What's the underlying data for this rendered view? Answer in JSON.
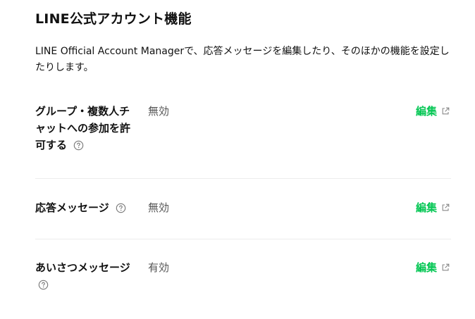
{
  "section": {
    "title": "LINE公式アカウント機能",
    "description": "LINE Official Account Managerで、応答メッセージを編集したり、そのほかの機能を設定したりします。"
  },
  "rows": [
    {
      "label": "グループ・複数人チャットへの参加を許可する",
      "status": "無効",
      "edit": "編集",
      "help_icon": "question-circle-icon",
      "edit_icon": "external-link-icon"
    },
    {
      "label": "応答メッセージ",
      "status": "無効",
      "edit": "編集",
      "help_icon": "question-circle-icon",
      "edit_icon": "external-link-icon"
    },
    {
      "label": "あいさつメッセージ",
      "status": "有効",
      "edit": "編集",
      "help_icon": "question-circle-icon",
      "edit_icon": "external-link-icon"
    }
  ],
  "colors": {
    "accent": "#06c755",
    "divider": "#ececec",
    "muted": "#555555"
  }
}
